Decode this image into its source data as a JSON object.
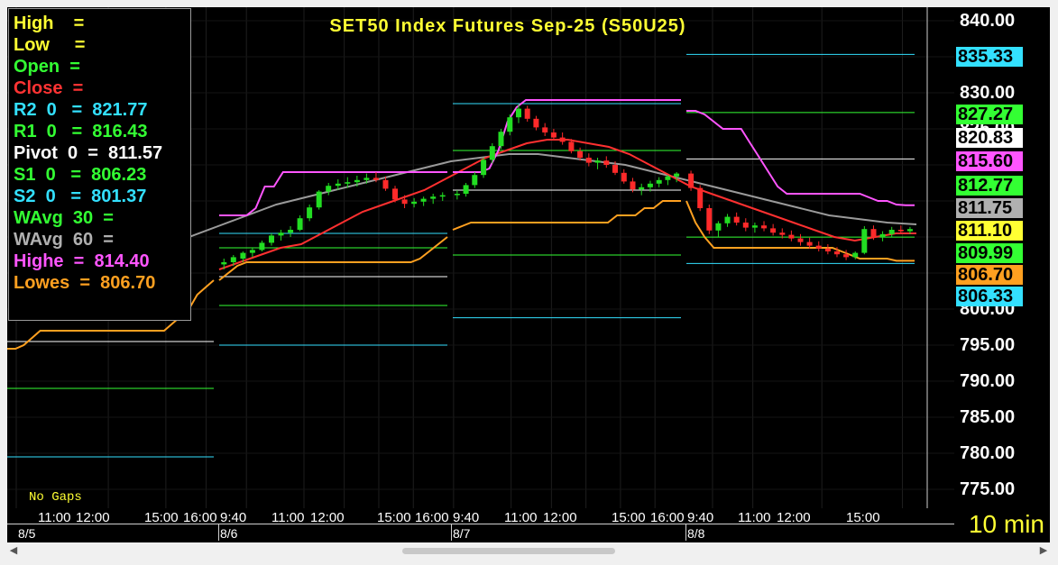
{
  "chart_title": "SET50  Index  Futures  Sep-25  (S50U25)",
  "status_text": "No  Gaps",
  "timeframe_label": "10  min",
  "legend": [
    {
      "text": "High    =",
      "color": "#ffff33"
    },
    {
      "text": "Low     =",
      "color": "#ffff33"
    },
    {
      "text": "Open  =",
      "color": "#33ff33"
    },
    {
      "text": "Close  =",
      "color": "#ff3333"
    },
    {
      "text": "R2  0   =  821.77",
      "color": "#33e0ff"
    },
    {
      "text": "R1  0   =  816.43",
      "color": "#33ff33"
    },
    {
      "text": "Pivot  0  =  811.57",
      "color": "#ffffff"
    },
    {
      "text": "S1  0   =  806.23",
      "color": "#33ff33"
    },
    {
      "text": "S2  0   =  801.37",
      "color": "#33e0ff"
    },
    {
      "text": "WAvg  30  =",
      "color": "#33ff33"
    },
    {
      "text": "WAvg  60  =",
      "color": "#b0b0b0"
    },
    {
      "text": "Highe  =  814.40",
      "color": "#ff55ff"
    },
    {
      "text": "Lowes  =  806.70",
      "color": "#ffa020"
    }
  ],
  "y_axis_ticks": [
    "840.00",
    "830.00",
    "825.00",
    "800.00",
    "795.00",
    "790.00",
    "785.00",
    "780.00",
    "775.00"
  ],
  "price_tags": [
    {
      "label": "835.33",
      "bg": "#33e0ff",
      "value": 835.33
    },
    {
      "label": "827.27",
      "bg": "#33ff33",
      "value": 827.27
    },
    {
      "label": "820.83",
      "bg": "#ffffff",
      "value": 820.83
    },
    {
      "label": "815.60",
      "bg": "#ff55ff",
      "value": 815.6
    },
    {
      "label": "812.77",
      "bg": "#33ff33",
      "value": 812.77
    },
    {
      "label": "811.75",
      "bg": "#b0b0b0",
      "value": 811.75
    },
    {
      "label": "811.10",
      "bg": "#ffff33",
      "value": 811.1
    },
    {
      "label": "809.99",
      "bg": "#33ff33",
      "value": 809.99
    },
    {
      "label": "806.70",
      "bg": "#ffa020",
      "value": 806.7
    },
    {
      "label": "806.33",
      "bg": "#33e0ff",
      "value": 806.33
    }
  ],
  "x_axis": {
    "time_labels": [
      "11:00",
      "12:00",
      "15:00",
      "16:00",
      "9:40",
      "11:00",
      "12:00",
      "15:00",
      "16:00",
      "9:40",
      "11:00",
      "12:00",
      "15:00",
      "16:00",
      "9:40",
      "11:00",
      "12:00",
      "15:00"
    ],
    "date_labels": [
      "8/5",
      "8/6",
      "8/7",
      "8/8"
    ]
  },
  "chart_data": {
    "type": "candlestick",
    "title": "SET50  Index  Futures  Sep-25  (S50U25)",
    "ylim": [
      775,
      840
    ],
    "sessions": [
      "8/5",
      "8/6",
      "8/7",
      "8/8"
    ],
    "pivot_levels": [
      {
        "session": "8/5",
        "R2": null,
        "R1": null,
        "Pivot": 795.5,
        "S1": 789.0,
        "S2": 779.5
      },
      {
        "session": "8/6",
        "R2": 810.5,
        "R1": 808.5,
        "Pivot": 804.5,
        "S1": 800.5,
        "S2": 795.0
      },
      {
        "session": "8/7",
        "R2": 828.5,
        "R1": 822.0,
        "Pivot": 816.5,
        "S1": 807.5,
        "S2": 798.8
      },
      {
        "session": "8/8",
        "R2": 835.33,
        "R1": 827.27,
        "Pivot": 820.83,
        "S1": 809.99,
        "S2": 806.33
      }
    ],
    "highest_high": [
      {
        "session": "8/6",
        "values": [
          813.0,
          813.0,
          813.0,
          813.0,
          814.0,
          817.0,
          817.0,
          819.0,
          819.0,
          819.0,
          819.0,
          819.0,
          819.0,
          819.0,
          819.0,
          819.0,
          819.0,
          819.0,
          819.0,
          819.0,
          819.0,
          819.0,
          819.0,
          819.0,
          819.0,
          819.0
        ]
      },
      {
        "session": "8/7",
        "values": [
          819.0,
          819.0,
          819.0,
          819.0,
          819.5,
          822.0,
          826.0,
          828.0,
          829.0,
          829.0,
          829.0,
          829.0,
          829.0,
          829.0,
          829.0,
          829.0,
          829.0,
          829.0,
          829.0,
          829.0,
          829.0,
          829.0,
          829.0,
          829.0,
          829.0,
          829.0
        ]
      },
      {
        "session": "8/8",
        "values": [
          827.5,
          827.5,
          827.0,
          826.0,
          825.0,
          825.0,
          825.0,
          823.0,
          821.0,
          819.0,
          817.0,
          816.0,
          816.0,
          816.0,
          816.0,
          816.0,
          816.0,
          816.0,
          816.0,
          816.0,
          815.5,
          815.0,
          815.0,
          814.5,
          814.4,
          814.4
        ]
      }
    ],
    "lowest_low": [
      {
        "session": "8/5",
        "values": [
          794.5,
          794.5,
          795.0,
          796.0,
          797.0,
          797.0,
          797.0,
          797.0,
          797.0,
          797.0,
          797.0,
          797.0,
          797.0,
          797.0,
          797.0,
          797.0,
          797.0,
          797.0,
          797.0,
          797.0,
          798.0,
          799.0,
          800.0,
          802.0,
          803.0,
          804.0
        ]
      },
      {
        "session": "8/6",
        "values": [
          804.0,
          805.0,
          806.0,
          806.5,
          806.5,
          806.5,
          806.5,
          806.5,
          806.5,
          806.5,
          806.5,
          806.5,
          806.5,
          806.5,
          806.5,
          806.5,
          806.5,
          806.5,
          806.5,
          806.5,
          806.5,
          806.5,
          807.0,
          808.0,
          809.0,
          810.0
        ]
      },
      {
        "session": "8/7",
        "values": [
          811.0,
          811.5,
          812.0,
          812.0,
          812.0,
          812.0,
          812.0,
          812.0,
          812.0,
          812.0,
          812.0,
          812.0,
          812.0,
          812.0,
          812.0,
          812.0,
          812.0,
          812.0,
          813.0,
          813.0,
          813.0,
          814.0,
          814.0,
          815.0,
          815.0,
          815.0
        ]
      },
      {
        "session": "8/8",
        "values": [
          815.0,
          812.0,
          810.0,
          808.5,
          808.5,
          808.5,
          808.5,
          808.5,
          808.5,
          808.5,
          808.5,
          808.5,
          808.5,
          808.5,
          808.5,
          808.5,
          808.5,
          808.0,
          807.5,
          807.0,
          807.0,
          807.0,
          807.0,
          806.7,
          806.7,
          806.7
        ]
      }
    ],
    "wavg30": [
      805.5,
      806.5,
      807.5,
      808.5,
      809.0,
      810.5,
      812.0,
      813.5,
      814.5,
      815.5,
      816.5,
      818.0,
      819.5,
      821.0,
      822.0,
      823.0,
      823.5,
      823.5,
      823.0,
      822.5,
      821.5,
      820.0,
      818.5,
      817.0,
      816.0,
      815.0,
      814.0,
      813.0,
      812.0,
      811.0,
      810.0,
      809.5,
      810.0,
      810.5,
      810.5
    ],
    "wavg60": [
      804.0,
      805.0,
      806.0,
      807.0,
      808.0,
      809.0,
      810.0,
      811.5,
      813.0,
      814.5,
      815.5,
      816.5,
      817.5,
      818.5,
      819.5,
      820.5,
      821.0,
      821.5,
      821.5,
      821.0,
      820.5,
      820.0,
      819.0,
      818.0,
      817.0,
      816.0,
      815.0,
      814.0,
      813.0,
      812.5,
      812.0,
      811.75
    ],
    "candles": [
      {
        "session": "8/6",
        "ohlc": [
          [
            806.2,
            807.0,
            805.5,
            806.5
          ],
          [
            806.5,
            807.5,
            806.0,
            807.2
          ],
          [
            807.0,
            808.0,
            806.5,
            807.8
          ],
          [
            807.8,
            808.5,
            807.2,
            808.2
          ],
          [
            808.2,
            809.5,
            808.0,
            809.2
          ],
          [
            809.2,
            810.5,
            808.8,
            810.2
          ],
          [
            810.2,
            811.0,
            809.5,
            810.6
          ],
          [
            810.6,
            811.5,
            810.0,
            811.0
          ],
          [
            811.0,
            813.0,
            810.8,
            812.6
          ],
          [
            812.6,
            814.5,
            812.2,
            814.1
          ],
          [
            814.1,
            816.5,
            813.8,
            816.3
          ],
          [
            816.3,
            817.5,
            815.8,
            817.1
          ],
          [
            817.1,
            818.0,
            816.5,
            817.4
          ],
          [
            817.4,
            818.3,
            816.8,
            817.6
          ],
          [
            817.6,
            818.5,
            817.0,
            817.9
          ],
          [
            817.9,
            818.8,
            817.4,
            818.2
          ],
          [
            818.2,
            819.0,
            817.6,
            817.9
          ],
          [
            817.9,
            818.4,
            816.4,
            816.7
          ],
          [
            816.7,
            817.1,
            814.8,
            815.2
          ],
          [
            815.2,
            815.8,
            814.0,
            814.6
          ],
          [
            814.6,
            815.4,
            814.1,
            814.9
          ],
          [
            814.9,
            815.6,
            814.3,
            815.3
          ],
          [
            815.3,
            816.0,
            814.6,
            815.6
          ],
          [
            815.6,
            816.2,
            815.0,
            815.8
          ]
        ]
      },
      {
        "session": "8/7",
        "ohlc": [
          [
            815.8,
            816.5,
            815.2,
            816.0
          ],
          [
            816.0,
            817.5,
            815.6,
            817.2
          ],
          [
            817.2,
            819.0,
            816.8,
            818.6
          ],
          [
            818.6,
            821.0,
            818.2,
            820.7
          ],
          [
            820.7,
            823.0,
            820.2,
            822.6
          ],
          [
            822.6,
            825.0,
            822.2,
            824.6
          ],
          [
            824.6,
            827.0,
            824.1,
            826.6
          ],
          [
            826.6,
            828.4,
            825.8,
            827.8
          ],
          [
            827.8,
            828.2,
            826.0,
            826.4
          ],
          [
            826.4,
            826.8,
            824.8,
            825.2
          ],
          [
            825.2,
            825.8,
            824.0,
            824.5
          ],
          [
            824.5,
            825.0,
            823.4,
            823.8
          ],
          [
            823.8,
            824.5,
            822.8,
            823.2
          ],
          [
            823.2,
            823.6,
            821.6,
            821.9
          ],
          [
            821.9,
            822.4,
            820.6,
            821.0
          ],
          [
            821.0,
            821.6,
            819.8,
            820.3
          ],
          [
            820.3,
            821.0,
            819.4,
            820.6
          ],
          [
            820.6,
            821.2,
            819.6,
            820.0
          ],
          [
            820.0,
            820.5,
            818.6,
            818.9
          ],
          [
            818.9,
            819.4,
            817.4,
            817.7
          ],
          [
            817.7,
            818.2,
            816.2,
            816.6
          ],
          [
            816.6,
            817.4,
            815.8,
            816.9
          ],
          [
            816.9,
            817.8,
            816.3,
            817.4
          ],
          [
            817.4,
            818.3,
            816.9,
            817.9
          ],
          [
            817.9,
            818.6,
            817.2,
            818.4
          ],
          [
            818.4,
            819.0,
            817.6,
            818.8
          ]
        ]
      },
      {
        "session": "8/8",
        "ohlc": [
          [
            818.8,
            819.2,
            816.4,
            816.8
          ],
          [
            816.8,
            817.2,
            813.6,
            814.0
          ],
          [
            814.0,
            814.5,
            810.4,
            810.9
          ],
          [
            810.9,
            812.2,
            810.0,
            811.9
          ],
          [
            811.9,
            813.2,
            811.4,
            812.8
          ],
          [
            812.8,
            813.4,
            811.6,
            812.0
          ],
          [
            812.0,
            812.6,
            810.8,
            811.3
          ],
          [
            811.3,
            812.0,
            810.6,
            811.6
          ],
          [
            811.6,
            812.2,
            810.8,
            811.2
          ],
          [
            811.2,
            811.8,
            810.2,
            810.6
          ],
          [
            810.6,
            811.2,
            809.8,
            810.3
          ],
          [
            810.3,
            810.9,
            809.4,
            809.8
          ],
          [
            809.8,
            810.4,
            808.8,
            809.3
          ],
          [
            809.3,
            809.9,
            808.4,
            808.8
          ],
          [
            808.8,
            809.4,
            808.0,
            808.4
          ],
          [
            808.4,
            809.0,
            807.6,
            808.0
          ],
          [
            808.0,
            808.6,
            807.2,
            807.6
          ],
          [
            807.6,
            808.2,
            806.8,
            807.2
          ],
          [
            807.2,
            808.0,
            806.9,
            807.8
          ],
          [
            807.8,
            811.5,
            807.6,
            811.1
          ],
          [
            811.1,
            811.6,
            809.6,
            810.0
          ],
          [
            810.0,
            810.8,
            809.4,
            810.4
          ],
          [
            810.4,
            811.4,
            810.0,
            811.0
          ],
          [
            811.0,
            811.6,
            810.4,
            810.8
          ],
          [
            810.8,
            811.4,
            810.4,
            811.1
          ]
        ]
      }
    ]
  }
}
